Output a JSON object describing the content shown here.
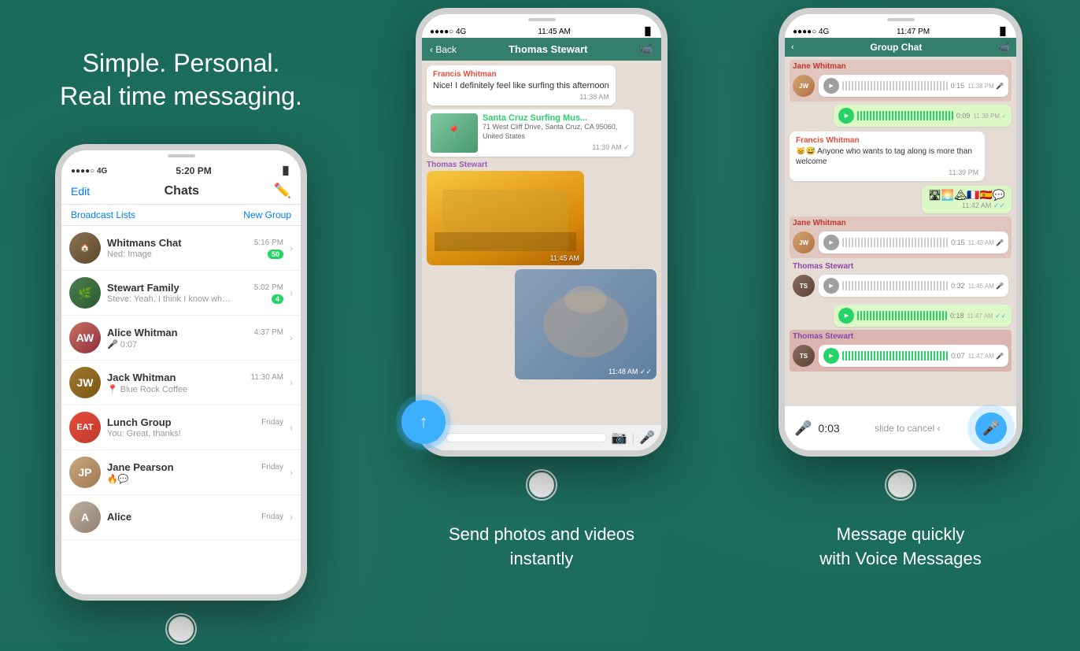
{
  "tagline": {
    "line1": "Simple. Personal.",
    "line2": "Real time messaging."
  },
  "phone1": {
    "status_bar": {
      "signal": "●●●●○ 4G",
      "time": "5:20 PM",
      "battery": "▐▌"
    },
    "nav": {
      "edit": "Edit",
      "title": "Chats",
      "compose": "✏"
    },
    "actions": {
      "broadcast": "Broadcast Lists",
      "new_group": "New Group"
    },
    "chats": [
      {
        "name": "Whitmans Chat",
        "time": "5:16 PM",
        "sender": "Ned:",
        "preview": "Image",
        "badge": "50",
        "avatar_class": "av-whitmans",
        "avatar_text": "🏠"
      },
      {
        "name": "Stewart Family",
        "time": "5:02 PM",
        "sender": "Steve:",
        "preview": "Yeah, I think I know wha...",
        "badge": "4",
        "avatar_class": "av-stewart",
        "avatar_text": "🌿"
      },
      {
        "name": "Alice Whitman",
        "time": "4:37 PM",
        "sender": "",
        "preview": "🎤 0:07",
        "badge": "",
        "avatar_class": "av-alice",
        "avatar_text": "A"
      },
      {
        "name": "Jack Whitman",
        "time": "11:30 AM",
        "sender": "",
        "preview": "📍 Blue Rock Coffee",
        "badge": "",
        "avatar_class": "av-jack",
        "avatar_text": "J"
      },
      {
        "name": "Lunch Group",
        "time": "Friday",
        "sender": "You:",
        "preview": "Great, thanks!",
        "badge": "",
        "avatar_class": "av-lunch",
        "avatar_text": "EAT"
      },
      {
        "name": "Jane Pearson",
        "time": "Friday",
        "sender": "",
        "preview": "🔥💬",
        "badge": "",
        "avatar_class": "av-jane",
        "avatar_text": "JP"
      },
      {
        "name": "Alice",
        "time": "Friday",
        "sender": "",
        "preview": "",
        "badge": "",
        "avatar_class": "av-alice2",
        "avatar_text": "A"
      }
    ]
  },
  "phone2": {
    "messages": [
      {
        "type": "incoming_text",
        "sender": "Francis Whitman",
        "text": "Nice! I definitely feel like surfing this afternoon",
        "time": "11:38 AM"
      },
      {
        "type": "incoming_location",
        "sender_hidden": true,
        "location_name": "Santa Cruz Surfing Mus...",
        "location_addr": "71 West Cliff Drive, Santa Cruz, CA 95060, United States",
        "time": "11:39 AM",
        "checkmarks": "✓"
      },
      {
        "type": "incoming_video",
        "sender": "Thomas Stewart",
        "time": "11:45 AM"
      },
      {
        "type": "outgoing_photo",
        "time": "11:48 AM",
        "checkmarks": "✓✓"
      }
    ],
    "label": "Send photos and videos\ninstantly"
  },
  "phone3": {
    "nav_name": "Group Chat",
    "voice_messages": [
      {
        "type": "incoming",
        "sender": "Jane Whitman",
        "duration": "0:15",
        "time": "11:38 PM",
        "mic_icon": "🎤"
      },
      {
        "type": "outgoing",
        "duration": "0:09",
        "time": "11:38 PM",
        "checkmarks": "✓"
      },
      {
        "type": "section_header",
        "sender": "Francis Whitman",
        "text": "😸😅 Anyone who wants to tag along is more than welcome",
        "time": "11:39 PM"
      },
      {
        "type": "emoji_row",
        "emojis": "🛣🌅🏔🇫🇷🇪🇸💬",
        "time": "11:42 AM",
        "checkmarks": "✓✓"
      },
      {
        "type": "incoming",
        "sender": "Jane Whitman",
        "duration": "0:15",
        "time": "11:43 AM",
        "mic_icon": "🎤",
        "section_color": "red"
      },
      {
        "type": "incoming",
        "sender": "Thomas Stewart",
        "duration": "0:32",
        "time": "11:45 AM",
        "mic_icon": "🎤"
      },
      {
        "type": "outgoing",
        "duration": "0:18",
        "time": "11:47 AM",
        "checkmarks": "✓✓"
      },
      {
        "type": "incoming",
        "sender": "Thomas Stewart",
        "duration": "0:07",
        "time": "11:47 AM",
        "mic_icon": "🎤",
        "section_color": "highlight"
      }
    ],
    "recording": {
      "time": "0:03",
      "cancel_text": "slide to cancel ‹"
    },
    "label": "Message quickly\nwith Voice Messages"
  },
  "labels": {
    "section2": "Send photos and videos\ninstantly",
    "section3": "Message quickly\nwith Voice Messages"
  }
}
